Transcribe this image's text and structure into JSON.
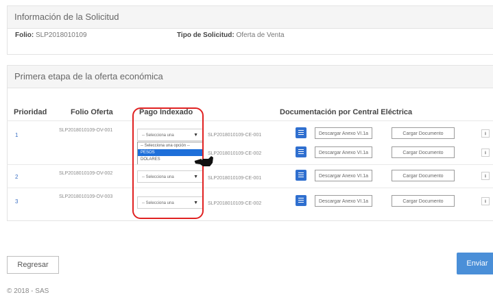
{
  "info_panel": {
    "title": "Información de la Solicitud",
    "folio_label": "Folio:",
    "folio_value": "SLP2018010109",
    "tipo_label": "Tipo de Solicitud:",
    "tipo_value": "Oferta de Venta"
  },
  "offer_panel": {
    "title": "Primera etapa de la oferta económica",
    "headers": [
      "Prioridad",
      "Folio Oferta",
      "Pago Indexado",
      "Documentación por Central Eléctrica"
    ],
    "rows": [
      {
        "prioridad": "1",
        "folio": "SLP2018010109-OV-001",
        "select": "-- Selecciona una",
        "ce": "SLP2018010109-CE-001"
      },
      {
        "prioridad": "",
        "folio": "",
        "select": "",
        "ce": "SLP2018010109-CE-002"
      },
      {
        "prioridad": "2",
        "folio": "SLP2018010109-OV-002",
        "select": "-- Selecciona una",
        "ce": "SLP2018010109-CE-001"
      },
      {
        "prioridad": "3",
        "folio": "SLP2018010109-OV-003",
        "select": "-- Selecciona una",
        "ce": "SLP2018010109-CE-002"
      }
    ],
    "dropdown_options": [
      "-- Selecciona una opción --",
      "PESOS",
      "DOLARES"
    ],
    "dropdown_highlight": "PESOS",
    "descargar_label": "Descargar Anexo VI.1a",
    "cargar_label": "Cargar Documento",
    "download_icon": "⭳"
  },
  "actions": {
    "regresar": "Regresar",
    "enviar": "Enviar"
  },
  "footer": "© 2018 - SAS",
  "colors": {
    "annotation": "#e02020",
    "primary": "#4a8fd8",
    "link": "#3a6fc4"
  }
}
